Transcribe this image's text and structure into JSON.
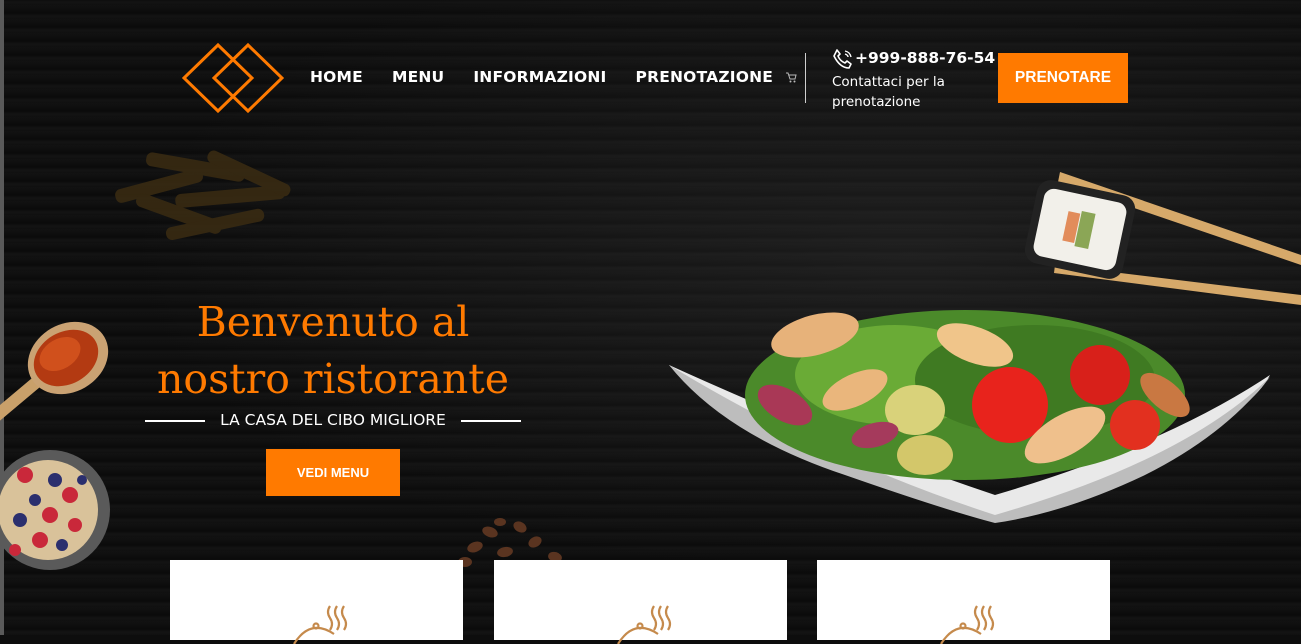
{
  "nav": {
    "items": [
      "HOME",
      "MENU",
      "INFORMAZIONI",
      "PRENOTAZIONE"
    ]
  },
  "contact": {
    "phone": "+999-888-76-54",
    "text": "Contattaci per la prenotazione"
  },
  "header": {
    "book_button": "PRENOTARE"
  },
  "hero": {
    "title": "Benvenuto al nostro ristorante",
    "tagline": "LA CASA DEL CIBO MIGLIORE",
    "cta": "VEDI MENU"
  },
  "colors": {
    "accent": "#ff7a00",
    "background": "#0e0e0e",
    "icon_brown": "#c58a4c"
  },
  "icons": [
    "logo-diamond-icon",
    "cart-icon",
    "phone-icon",
    "dish-steam-icon"
  ]
}
